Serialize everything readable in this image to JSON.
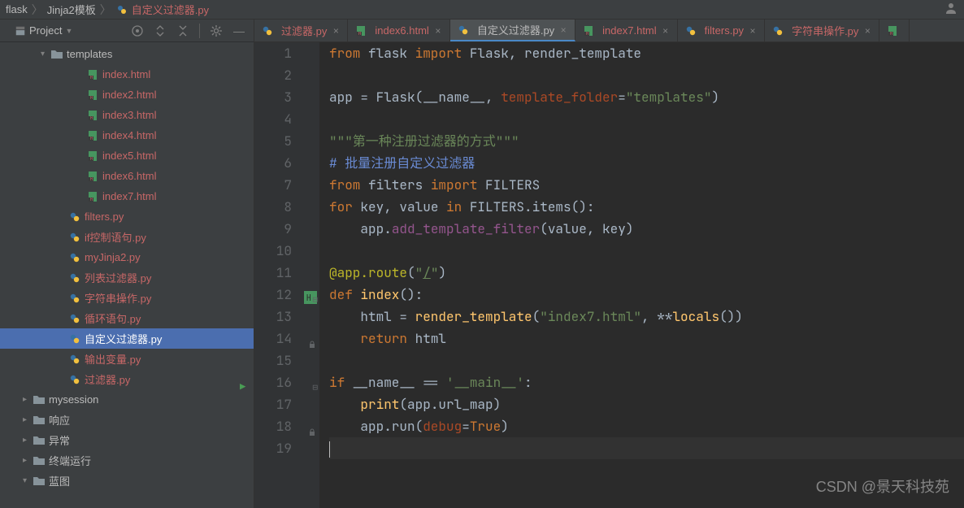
{
  "breadcrumb": {
    "items": [
      {
        "label": "flask",
        "icon": "folder"
      },
      {
        "label": "Jinja2模板",
        "icon": "folder"
      },
      {
        "label": "自定义过滤器.py",
        "icon": "python",
        "colored": true
      }
    ]
  },
  "sidebar": {
    "title": "Project",
    "tree": [
      {
        "indent": 50,
        "arrow": "down",
        "icon": "folder",
        "label": "templates",
        "color": "#bbbbbb"
      },
      {
        "indent": 94,
        "icon": "html",
        "label": "index.html"
      },
      {
        "indent": 94,
        "icon": "html",
        "label": "index2.html"
      },
      {
        "indent": 94,
        "icon": "html",
        "label": "index3.html"
      },
      {
        "indent": 94,
        "icon": "html",
        "label": "index4.html"
      },
      {
        "indent": 94,
        "icon": "html",
        "label": "index5.html"
      },
      {
        "indent": 94,
        "icon": "html",
        "label": "index6.html"
      },
      {
        "indent": 94,
        "icon": "html",
        "label": "index7.html"
      },
      {
        "indent": 72,
        "icon": "python",
        "label": "filters.py"
      },
      {
        "indent": 72,
        "icon": "python",
        "label": "if控制语句.py"
      },
      {
        "indent": 72,
        "icon": "python",
        "label": "myJinja2.py"
      },
      {
        "indent": 72,
        "icon": "python",
        "label": "列表过滤器.py"
      },
      {
        "indent": 72,
        "icon": "python",
        "label": "字符串操作.py"
      },
      {
        "indent": 72,
        "icon": "python",
        "label": "循环语句.py"
      },
      {
        "indent": 72,
        "icon": "python",
        "label": "自定义过滤器.py",
        "selected": true
      },
      {
        "indent": 72,
        "icon": "python",
        "label": "输出变量.py"
      },
      {
        "indent": 72,
        "icon": "python",
        "label": "过滤器.py"
      },
      {
        "indent": 28,
        "arrow": "right",
        "icon": "folder",
        "label": "mysession",
        "color": "#bbbbbb"
      },
      {
        "indent": 28,
        "arrow": "right",
        "icon": "folder",
        "label": "响应",
        "color": "#bbbbbb"
      },
      {
        "indent": 28,
        "arrow": "right",
        "icon": "folder",
        "label": "异常",
        "color": "#bbbbbb"
      },
      {
        "indent": 28,
        "arrow": "right",
        "icon": "folder",
        "label": "终端运行",
        "color": "#bbbbbb"
      },
      {
        "indent": 28,
        "arrow": "down",
        "icon": "folder",
        "label": "蓝图",
        "color": "#bbbbbb"
      }
    ]
  },
  "tabs": [
    {
      "icon": "python",
      "label": "过滤器.py",
      "colored": true
    },
    {
      "icon": "html",
      "label": "index6.html",
      "colored": true
    },
    {
      "icon": "python",
      "label": "自定义过滤器.py",
      "active": true,
      "colored": false
    },
    {
      "icon": "html",
      "label": "index7.html",
      "colored": true
    },
    {
      "icon": "python",
      "label": "filters.py",
      "colored": true
    },
    {
      "icon": "python",
      "label": "字符串操作.py",
      "colored": true
    }
  ],
  "code": {
    "lines": [
      {
        "n": 1,
        "html": "<span class='kw'>from</span> flask <span class='kw'>import</span> Flask, render_template"
      },
      {
        "n": 2,
        "html": ""
      },
      {
        "n": 3,
        "html": "app = Flask(__name__, <span class='par'>template_folder</span>=<span class='str'>\"templates\"</span>)"
      },
      {
        "n": 4,
        "html": ""
      },
      {
        "n": 5,
        "html": "<span class='str'>\"\"\"第一种注册过滤器的方式\"\"\"</span>"
      },
      {
        "n": 6,
        "html": "<span class='cmt'># 批量注册自定义过滤器</span>",
        "blueComment": true
      },
      {
        "n": 7,
        "html": "<span class='kw'>from</span> filters <span class='kw'>import</span> FILTERS"
      },
      {
        "n": 8,
        "html": "<span class='kw'>for</span> key, value <span class='kw'>in</span> FILTERS.items():"
      },
      {
        "n": 9,
        "html": "    app.<span class='self'>add_template_filter</span>(value, key)"
      },
      {
        "n": 10,
        "html": ""
      },
      {
        "n": 11,
        "html": "<span class='dec'>@app.route</span>(<span class='str'>\"<span style='text-decoration:underline'>/</span>\"</span>)"
      },
      {
        "n": 12,
        "html": "<span class='kw'>def </span><span class='defname'>index</span>():",
        "hmark": true,
        "fold": true
      },
      {
        "n": 13,
        "html": "    html = <span class='fn'>render_template</span>(<span class='str'>\"index7.html\"</span>, **<span class='fn'>locals</span>())"
      },
      {
        "n": 14,
        "html": "    <span class='kw'>return</span> html",
        "lock": true
      },
      {
        "n": 15,
        "html": ""
      },
      {
        "n": 16,
        "html": "<span class='kw'>if</span> __name__ == <span class='str'>'__main__'</span>:",
        "run": true,
        "fold": true
      },
      {
        "n": 17,
        "html": "    <span class='fn'>print</span>(app.url_map)"
      },
      {
        "n": 18,
        "html": "    app.run(<span class='par'>debug</span>=<span class='kw'>True</span>)",
        "lock": true
      },
      {
        "n": 19,
        "html": "<span class='cursor'></span>",
        "cursor": true
      }
    ]
  },
  "watermark": "CSDN @景天科技苑"
}
